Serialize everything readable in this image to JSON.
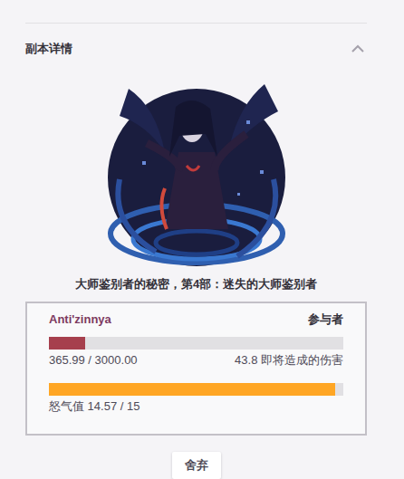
{
  "section": {
    "title": "副本详情",
    "expanded": true
  },
  "quest": {
    "title": "大师鉴别者的秘密，第4部：迷失的大师鉴别者"
  },
  "boss": {
    "name": "Anti'zinnya",
    "participants_label": "参与者",
    "health": {
      "level": 0.122,
      "reading": "365.99 / 3000.00"
    },
    "pending_damage": "43.8 即将造成的伤害",
    "rage": {
      "level": 0.971,
      "reading": "怒气值 14.57 / 15"
    }
  },
  "buttons": [
    "舍弃"
  ]
}
